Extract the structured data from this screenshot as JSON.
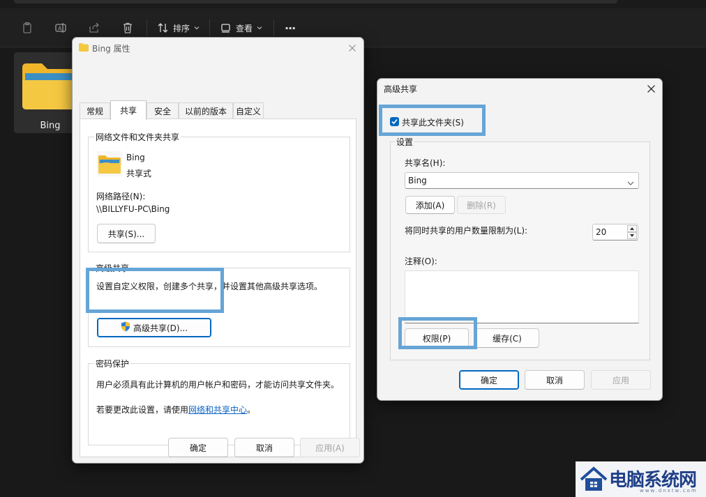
{
  "explorer": {
    "toolbar": {
      "sort_label": "排序",
      "view_label": "查看",
      "more_label": "···"
    },
    "folder": {
      "label": "Bing"
    }
  },
  "properties": {
    "title": "Bing 属性",
    "tabs": [
      "常规",
      "共享",
      "安全",
      "以前的版本",
      "自定义"
    ],
    "active_tab": "共享",
    "network_share": {
      "group_label": "网络文件和文件夹共享",
      "folder_name": "Bing",
      "status": "共享式",
      "path_label": "网络路径(N):",
      "path": "\\\\BILLYFU-PC\\Bing",
      "share_button": "共享(S)..."
    },
    "advanced": {
      "group_label": "高级共享",
      "description": "设置自定义权限，创建多个共享，并设置其他高级共享选项。",
      "button": "高级共享(D)..."
    },
    "password": {
      "group_label": "密码保护",
      "description": "用户必须具有此计算机的用户帐户和密码，才能访问共享文件夹。",
      "change_prefix": "若要更改此设置，请使用",
      "change_link": "网络和共享中心",
      "change_suffix": "。"
    },
    "buttons": {
      "ok": "确定",
      "cancel": "取消",
      "apply": "应用(A)"
    }
  },
  "advanced_dialog": {
    "title": "高级共享",
    "share_checkbox": {
      "label": "共享此文件夹(S)",
      "checked": true
    },
    "settings": {
      "group_label": "设置",
      "share_name_label": "共享名(H):",
      "share_name_value": "Bing",
      "add_button": "添加(A)",
      "remove_button": "删除(R)",
      "limit_label": "将同时共享的用户数量限制为(L):",
      "limit_value": "20",
      "comment_label": "注释(O):",
      "comment_value": "",
      "permissions_button": "权限(P)",
      "caching_button": "缓存(C)"
    },
    "buttons": {
      "ok": "确定",
      "cancel": "取消",
      "apply": "应用"
    }
  },
  "watermark": {
    "text": "电脑系统网",
    "subtext": "www.dnxtw.com"
  },
  "colors": {
    "accent": "#0067c0",
    "highlight": "#66a5d6",
    "folder": "#f5c842"
  }
}
